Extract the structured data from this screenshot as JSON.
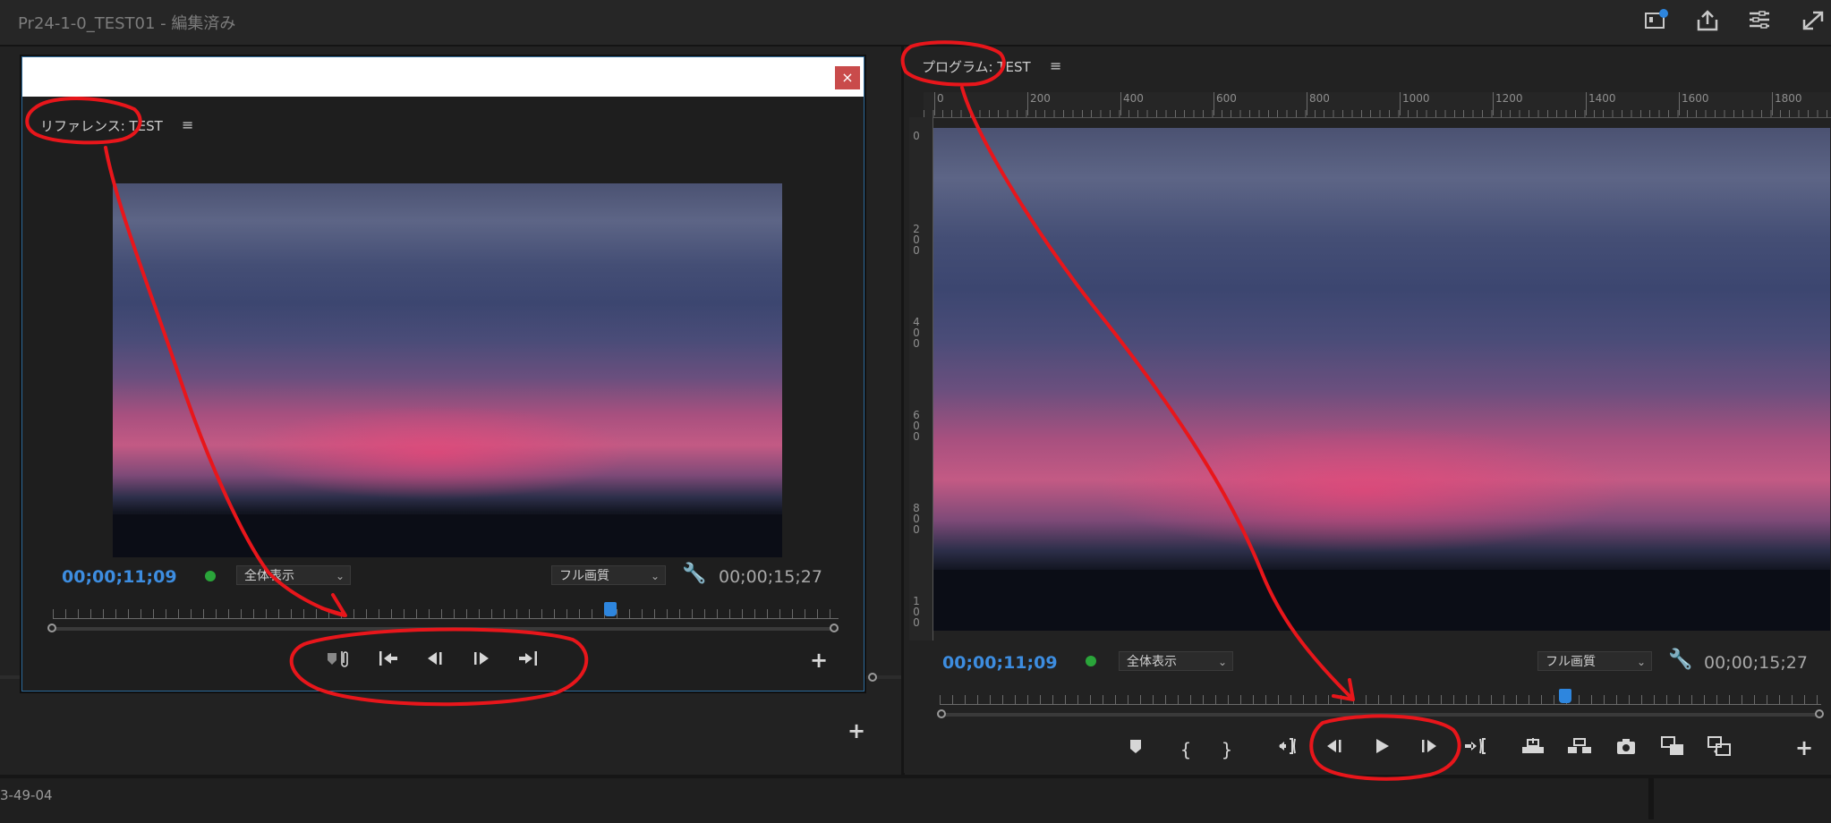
{
  "app": {
    "title": "Pr24-1-0_TEST01 - 編集済み",
    "toolbar_icons": [
      "quick-export-icon",
      "share-icon",
      "workspaces-icon",
      "fullscreen-icon"
    ]
  },
  "reference_monitor": {
    "title": "リファレンス: TEST",
    "timecode_current": "00;00;11;09",
    "timecode_duration": "00;00;15;27",
    "zoom_dropdown": "全体表示",
    "quality_dropdown": "フル画質",
    "playhead_fraction": 0.71,
    "controls": [
      "add-marker-icon",
      "step-back-edit-icon",
      "step-back-frame-icon",
      "step-forward-frame-icon",
      "step-forward-edit-icon"
    ],
    "close_label": "×",
    "add_button": "+"
  },
  "program_monitor": {
    "title": "プログラム: TEST",
    "timecode_current": "00;00;11;09",
    "timecode_duration": "00;00;15;27",
    "zoom_dropdown": "全体表示",
    "quality_dropdown": "フル画質",
    "playhead_fraction": 0.71,
    "ruler_h_labels": [
      "0",
      "200",
      "400",
      "600",
      "800",
      "1000",
      "1200",
      "1400",
      "1600",
      "1800"
    ],
    "ruler_v_labels": [
      "0",
      "200",
      "400",
      "600",
      "800",
      "100"
    ],
    "controls": [
      "add-marker-icon",
      "mark-in-icon",
      "mark-out-icon",
      "go-to-in-icon",
      "step-back-frame-icon",
      "play-icon",
      "step-forward-frame-icon",
      "go-to-out-icon",
      "lift-icon",
      "extract-icon",
      "export-frame-icon",
      "comparison-view-icon",
      "toggle-proxy-icon"
    ],
    "add_button": "+"
  },
  "bottom_panel": {
    "text": "3-49-04"
  },
  "colors": {
    "timecode_blue": "#3d8de0",
    "annotation_red": "#e8161b",
    "status_green": "#2aa53a"
  }
}
